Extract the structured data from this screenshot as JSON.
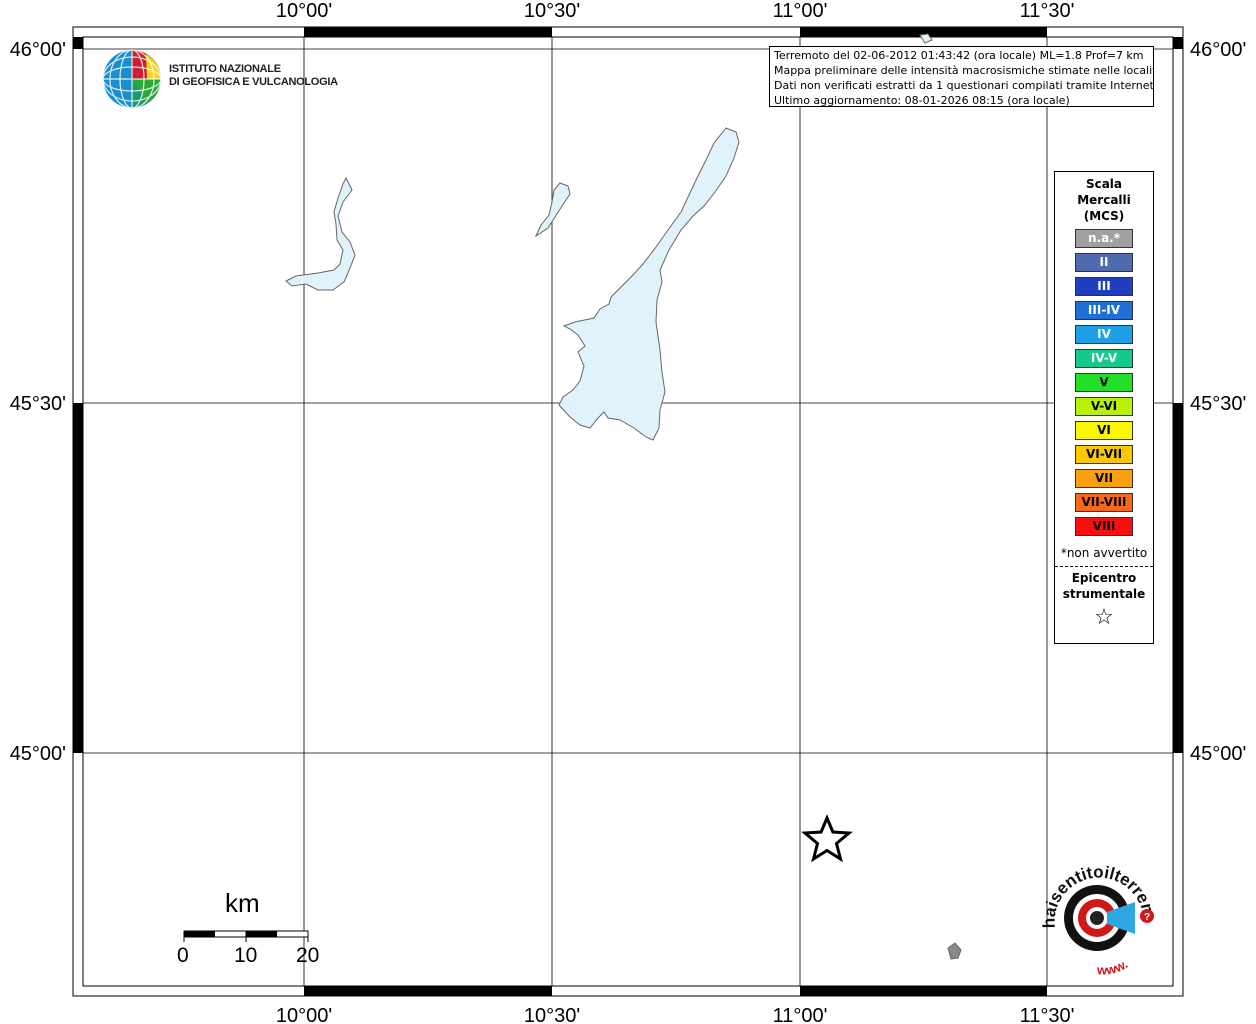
{
  "map": {
    "lon_labels": [
      "10°00'",
      "10°30'",
      "11°00'",
      "11°30'"
    ],
    "lat_labels": [
      "46°00'",
      "45°30'",
      "45°00'"
    ]
  },
  "info": {
    "line1": "Terremoto del 02-06-2012 01:43:42 (ora locale) ML=1.8 Prof=7 km",
    "line2": "Mappa preliminare delle intensità macrosismiche stimate nelle località",
    "line3": "Dati non verificati estratti da 1 questionari compilati tramite Internet.",
    "line4": "Ultimo aggiornamento: 08-01-2026 08:15 (ora locale)"
  },
  "ingv": {
    "line1": "ISTITUTO NAZIONALE",
    "line2": "DI GEOFISICA E VULCANOLOGIA"
  },
  "legend": {
    "title1": "Scala",
    "title2": "Mercalli",
    "title3": "(MCS)",
    "items": [
      {
        "label": "n.a.*",
        "color": "#a0a0a0"
      },
      {
        "label": "II",
        "color": "#4f6aad"
      },
      {
        "label": "III",
        "color": "#1f3fbf"
      },
      {
        "label": "III-IV",
        "color": "#1f6fd6"
      },
      {
        "label": "IV",
        "color": "#1f9fe6"
      },
      {
        "label": "IV-V",
        "color": "#16c88a"
      },
      {
        "label": "V",
        "color": "#22e02a"
      },
      {
        "label": "V-VI",
        "color": "#b8f00a"
      },
      {
        "label": "VI",
        "color": "#f8f800"
      },
      {
        "label": "VI-VII",
        "color": "#f8c800"
      },
      {
        "label": "VII",
        "color": "#f8a010"
      },
      {
        "label": "VII-VIII",
        "color": "#f86818"
      },
      {
        "label": "VIII",
        "color": "#f81010"
      }
    ],
    "note": "*non avvertito",
    "epicenter_line1": "Epicentro",
    "epicenter_line2": "strumentale",
    "epicenter_symbol": "☆"
  },
  "scale": {
    "unit": "km",
    "labels": [
      "0",
      "10",
      "20"
    ]
  },
  "haisentito": {
    "text": "haisentitoilterremoto.it",
    "www": "www."
  },
  "colors": {
    "lake_fill": "#e0f2fb",
    "lake_stroke": "#666666",
    "frame": "#000000"
  }
}
